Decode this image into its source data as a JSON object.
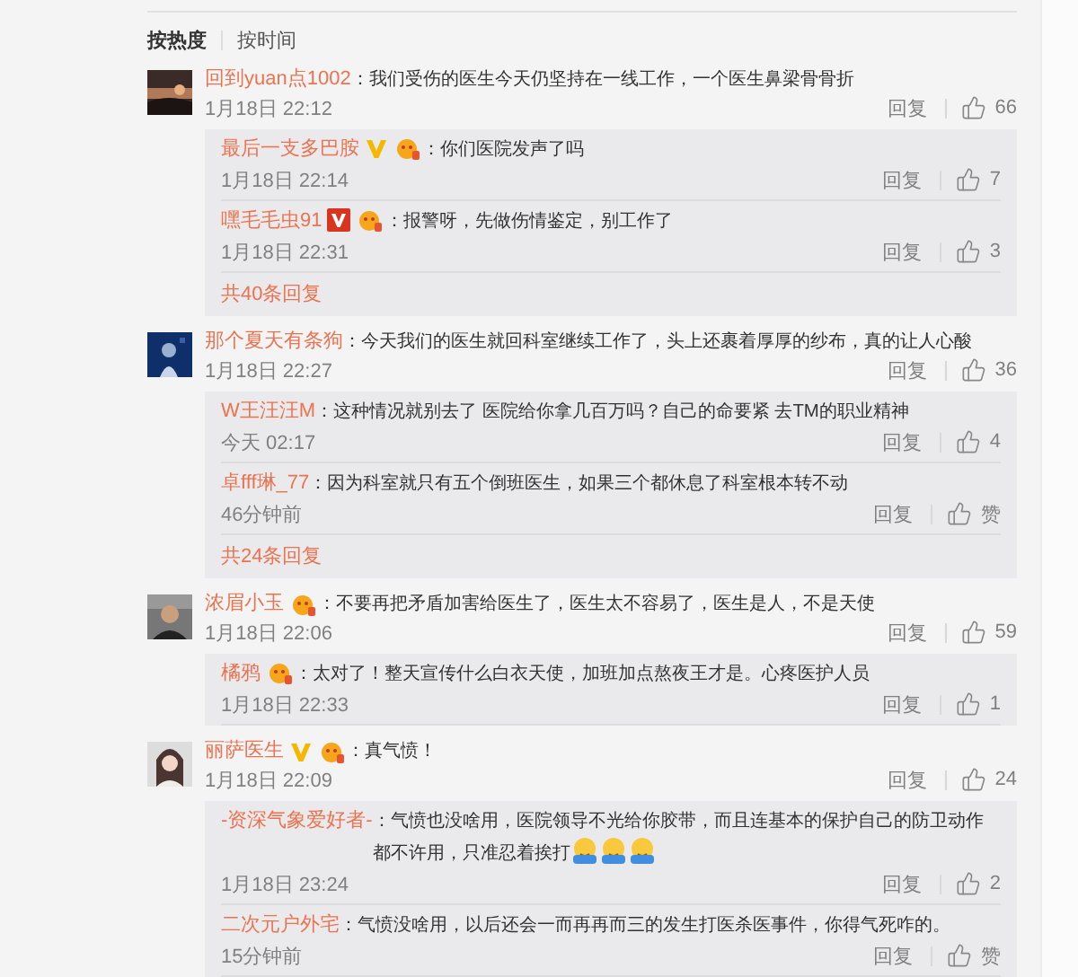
{
  "sort_tabs": [
    {
      "label": "按热度",
      "selected": true
    },
    {
      "label": "按时间",
      "selected": false
    }
  ],
  "comments": [
    {
      "avatar": {
        "kind": "picture"
      },
      "user": "回到yuan点1002",
      "text": "：我们受伤的医生今天仍坚持在一线工作，一个医生鼻梁骨骨折",
      "time": "1月18日 22:12",
      "reply_label": "回复",
      "likes": "66",
      "replies": [
        {
          "user": "最后一支多巴胺",
          "verified": {
            "color": "#f5b700"
          },
          "fan_badge": true,
          "text": "：你们医院发声了吗",
          "time": "1月18日 22:14",
          "reply_label": "回复",
          "likes": "7"
        },
        {
          "user": "嘿毛毛虫91",
          "verified": {
            "color": "#d9341f"
          },
          "fan_badge": true,
          "text": "：报警呀，先做伤情鉴定，别工作了",
          "time": "1月18日 22:31",
          "reply_label": "回复",
          "likes": "3"
        }
      ],
      "more": "共40条回复"
    },
    {
      "avatar": {
        "kind": "picture"
      },
      "user": "那个夏天有条狗",
      "text": "：今天我们的医生就回科室继续工作了，头上还裹着厚厚的纱布，真的让人心酸",
      "time": "1月18日 22:27",
      "reply_label": "回复",
      "likes": "36",
      "replies": [
        {
          "user": "W王汪汪M",
          "text": "：这种情况就别去了 医院给你拿几百万吗？自己的命要紧 去TM的职业精神",
          "time": "今天 02:17",
          "reply_label": "回复",
          "likes": "4"
        },
        {
          "user": "卓fff琳_77",
          "text": "：因为科室就只有五个倒班医生，如果三个都休息了科室根本转不动",
          "time": "46分钟前",
          "reply_label": "回复",
          "likes": "赞"
        }
      ],
      "more": "共24条回复"
    },
    {
      "avatar": {
        "kind": "picture"
      },
      "user": "浓眉小玉",
      "fan_badge": true,
      "text": "：不要再把矛盾加害给医生了，医生太不容易了，医生是人，不是天使",
      "time": "1月18日 22:06",
      "reply_label": "回复",
      "likes": "59",
      "replies": [
        {
          "user": "橘鸦",
          "fan_badge": true,
          "text": "：太对了！整天宣传什么白衣天使，加班加点熬夜王才是。心疼医护人员",
          "time": "1月18日 22:33",
          "reply_label": "回复",
          "likes": "1"
        }
      ]
    },
    {
      "avatar": {
        "kind": "picture"
      },
      "user": "丽萨医生",
      "verified": {
        "color": "#f5b700"
      },
      "fan_badge": true,
      "text": "：真气愤！",
      "time": "1月18日 22:09",
      "reply_label": "回复",
      "likes": "24",
      "replies": [
        {
          "user": "-资深气象爱好者-",
          "text": "：气愤也没啥用，医院领导不光给你胶带，而且连基本的保护自己的防卫动作都不许用，只准忍着挨打",
          "emojis": [
            {
              "kind": "hug"
            },
            {
              "kind": "hug"
            },
            {
              "kind": "hug"
            }
          ],
          "time": "1月18日 23:24",
          "reply_label": "回复",
          "likes": "2"
        },
        {
          "user": "二次元户外宅",
          "text": "：气愤没啥用，以后还会一而再再而三的发生打医杀医事件，你得气死咋的。",
          "time": "15分钟前",
          "reply_label": "回复",
          "likes": "赞"
        }
      ]
    }
  ]
}
